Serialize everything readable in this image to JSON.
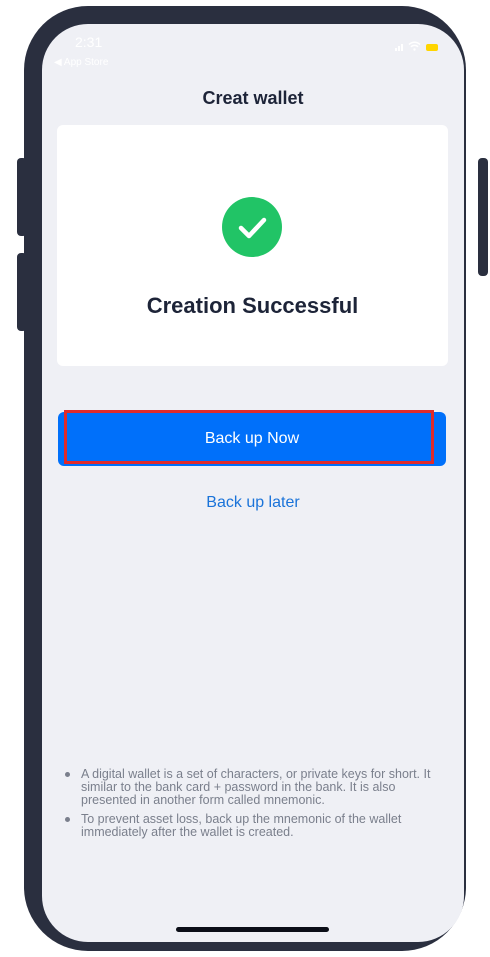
{
  "status_bar": {
    "time": "2:31",
    "back_label": "◀ App Store"
  },
  "nav": {
    "title": "Creat wallet"
  },
  "success_card": {
    "icon": "check-circle-icon",
    "message": "Creation Successful"
  },
  "actions": {
    "backup_now_label": "Back up Now",
    "backup_later_label": "Back up later"
  },
  "notes": [
    "A digital wallet is a set of characters, or private keys for short. It similar to the bank card + password in the bank. It is also presented in another form called mnemonic.",
    "To prevent asset loss, back up the mnemonic of the wallet immediately after the wallet is created."
  ],
  "colors": {
    "primary": "#0070fa",
    "success": "#21c466",
    "link": "#1a73d9",
    "highlight": "#e02b2b",
    "background": "#eff0f5"
  }
}
